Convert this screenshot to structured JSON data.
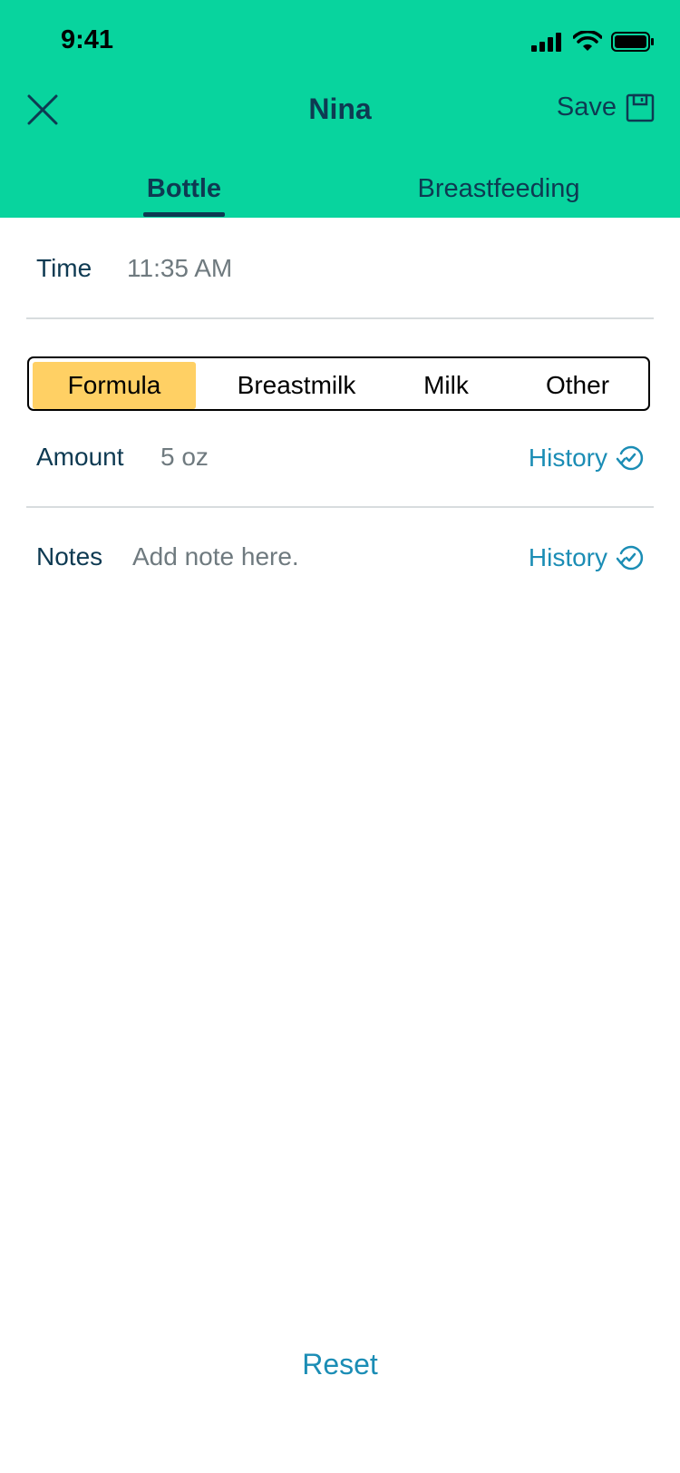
{
  "status": {
    "time": "9:41"
  },
  "nav": {
    "title": "Nina",
    "save_label": "Save"
  },
  "tabs": [
    {
      "label": "Bottle",
      "selected": true
    },
    {
      "label": "Breastfeeding",
      "selected": false
    }
  ],
  "time_row": {
    "label": "Time",
    "value": "11:35 AM"
  },
  "feed_types": [
    {
      "label": "Formula",
      "selected": true
    },
    {
      "label": "Breastmilk",
      "selected": false
    },
    {
      "label": "Milk",
      "selected": false
    },
    {
      "label": "Other",
      "selected": false
    }
  ],
  "amount_row": {
    "label": "Amount",
    "value": "5 oz",
    "history_label": "History"
  },
  "notes_row": {
    "label": "Notes",
    "placeholder": "Add note here.",
    "history_label": "History"
  },
  "footer": {
    "reset_label": "Reset"
  },
  "colors": {
    "header_bg": "#08d49e",
    "primary_text": "#0e3a52",
    "accent_link": "#1b8db5",
    "selected_segment": "#ffd064"
  }
}
